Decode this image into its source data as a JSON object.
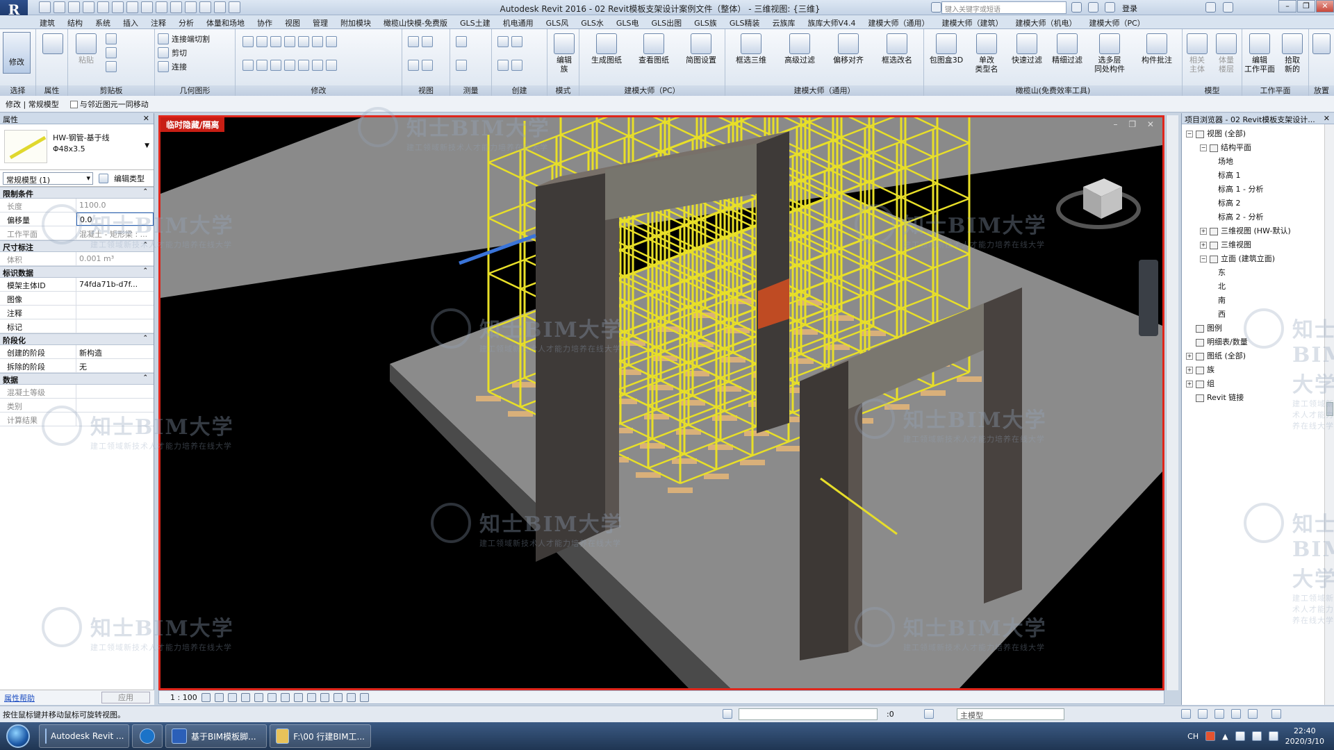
{
  "app": {
    "title": "Autodesk Revit 2016 -     02 Revit模板支架设计案例文件（整体） - 三维视图: {三维}",
    "logo_letter": "R",
    "search_placeholder": "键入关键字或短语",
    "login": "登录"
  },
  "ribbon_tabs": [
    "建筑",
    "结构",
    "系统",
    "插入",
    "注释",
    "分析",
    "体量和场地",
    "协作",
    "视图",
    "管理",
    "附加模块",
    "橄榄山快模-免费版",
    "GLS土建",
    "机电通用",
    "GLS风",
    "GLS水",
    "GLS电",
    "GLS出图",
    "GLS族",
    "GLS精装",
    "云族库",
    "族库大师V4.4",
    "建模大师（通用）",
    "建模大师（建筑）",
    "建模大师（机电）",
    "建模大师（PC）"
  ],
  "ribbon": {
    "modify": "修改",
    "panels": [
      "选择",
      "属性",
      "剪贴板",
      "几何图形",
      "修改",
      "视图",
      "测量",
      "创建",
      "模式",
      "建模大师（PC）",
      "建模大师（通用）",
      "橄榄山(免费效率工具)",
      "模型",
      "工作平面",
      "放置"
    ],
    "clipboard": {
      "paste": "粘贴",
      "cut": "剪切",
      "join": "连接",
      "connect_cut": "连接端切割"
    },
    "mode": {
      "edit_family": "编辑\n族"
    },
    "pc": [
      "生成图纸",
      "查看图纸",
      "简图设置"
    ],
    "general": [
      "框选三维",
      "高级过滤",
      "偏移对齐",
      "框选改名"
    ],
    "gls": [
      "包图盒3D",
      "单改\n类型名",
      "快速过滤",
      "精细过滤",
      "选多层\n同处构件",
      "构件批注"
    ],
    "model": [
      "相关\n主体",
      "体量\n楼层"
    ],
    "workplane": [
      "编辑\n工作平面",
      "拾取\n新的"
    ]
  },
  "options_bar": {
    "context": "修改 | 常规模型",
    "move_with_nearby": "与邻近图元一同移动"
  },
  "properties": {
    "title": "属性",
    "type_name": "HW-钢管-基于线\nΦ48x3.5",
    "instance_selector": "常规模型 (1)",
    "edit_type": "编辑类型",
    "groups": [
      {
        "name": "限制条件",
        "rows": [
          {
            "k": "长度",
            "v": "1100.0",
            "gray": true
          },
          {
            "k": "偏移量",
            "v": "0.0",
            "edit": true
          },
          {
            "k": "工作平面",
            "v": "混凝土 - 矩形梁 : ...",
            "gray": true
          }
        ]
      },
      {
        "name": "尺寸标注",
        "rows": [
          {
            "k": "体积",
            "v": "0.001 m³",
            "gray": true
          }
        ]
      },
      {
        "name": "标识数据",
        "rows": [
          {
            "k": "模架主体ID",
            "v": "74fda71b-d7f..."
          },
          {
            "k": "图像",
            "v": ""
          },
          {
            "k": "注释",
            "v": ""
          },
          {
            "k": "标记",
            "v": ""
          }
        ]
      },
      {
        "name": "阶段化",
        "rows": [
          {
            "k": "创建的阶段",
            "v": "新构造"
          },
          {
            "k": "拆除的阶段",
            "v": "无"
          }
        ]
      },
      {
        "name": "数据",
        "rows": [
          {
            "k": "混凝土等级",
            "v": "",
            "gray": true
          },
          {
            "k": "类别",
            "v": "",
            "gray": true
          },
          {
            "k": "计算结果",
            "v": "",
            "gray": true
          }
        ]
      }
    ],
    "help": "属性帮助",
    "apply": "应用"
  },
  "viewport": {
    "isolate_label": "临时隐藏/隔离",
    "scale": "1 : 100"
  },
  "project_browser": {
    "title": "项目浏览器 - 02 Revit模板支架设计...",
    "items": [
      {
        "label": "视图 (全部)",
        "level": 0,
        "exp": "−"
      },
      {
        "label": "结构平面",
        "level": 1,
        "exp": "−"
      },
      {
        "label": "场地",
        "level": 2
      },
      {
        "label": "标高 1",
        "level": 2
      },
      {
        "label": "标高 1 - 分析",
        "level": 2
      },
      {
        "label": "标高 2",
        "level": 2
      },
      {
        "label": "标高 2 - 分析",
        "level": 2
      },
      {
        "label": "三维视图 (HW-默认)",
        "level": 1,
        "exp": "+"
      },
      {
        "label": "三维视图",
        "level": 1,
        "exp": "+"
      },
      {
        "label": "立面 (建筑立面)",
        "level": 1,
        "exp": "−"
      },
      {
        "label": "东",
        "level": 2
      },
      {
        "label": "北",
        "level": 2
      },
      {
        "label": "南",
        "level": 2
      },
      {
        "label": "西",
        "level": 2
      },
      {
        "label": "图例",
        "level": 0
      },
      {
        "label": "明细表/数量",
        "level": 0
      },
      {
        "label": "图纸 (全部)",
        "level": 0,
        "exp": "+"
      },
      {
        "label": "族",
        "level": 0,
        "exp": "+"
      },
      {
        "label": "组",
        "level": 0,
        "exp": "+"
      },
      {
        "label": "Revit 链接",
        "level": 0
      }
    ]
  },
  "status": {
    "hint": "按住鼠标键并移动鼠标可旋转视图。",
    "count": ":0",
    "model": "主模型"
  },
  "taskbar": {
    "tasks": [
      "Autodesk Revit ...",
      "",
      "基于BIM模板脚...",
      "F:\\00 行建BIM工..."
    ],
    "lang": "CH",
    "time": "22:40",
    "date": "2020/3/10"
  },
  "watermark": {
    "brand": "知士BIM大学",
    "slogan": "建工领域新技术人才能力培养在线大学"
  }
}
